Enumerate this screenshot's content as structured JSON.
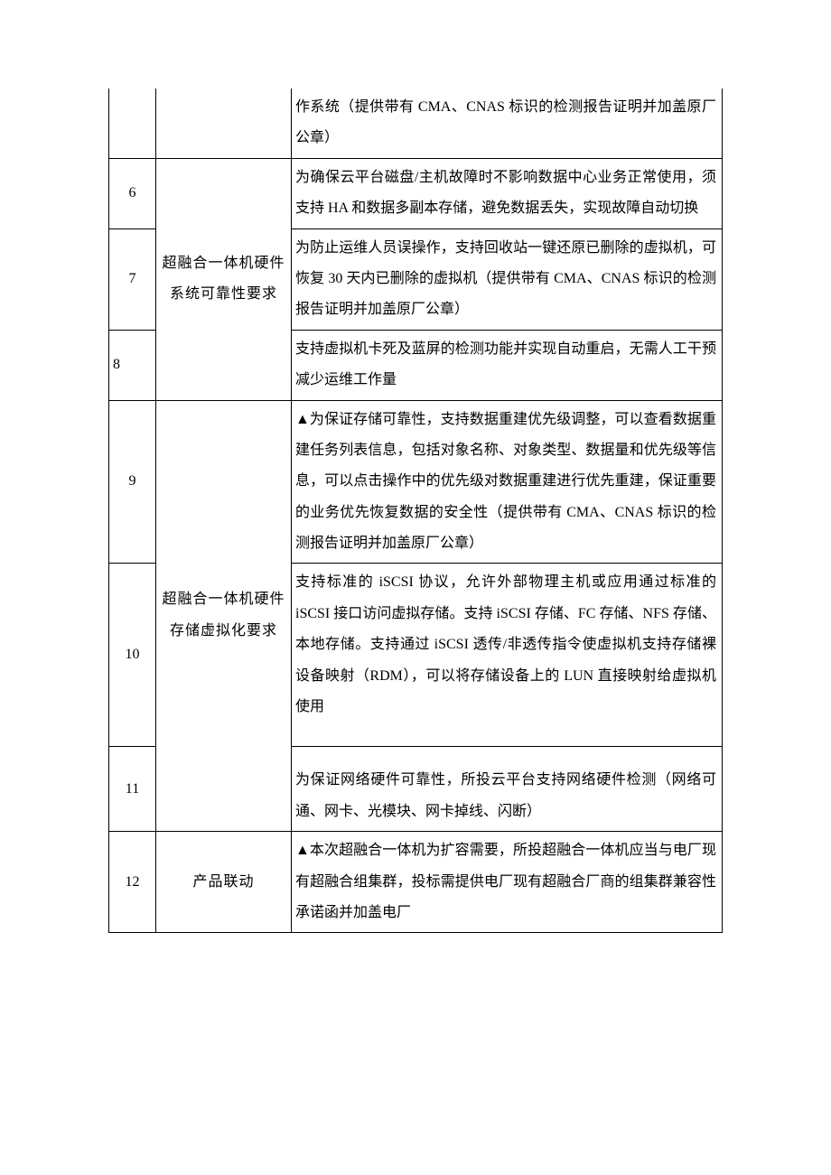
{
  "table": {
    "rows": [
      {
        "num": "",
        "cat": "",
        "desc": "作系统（提供带有 CMA、CNAS 标识的检测报告证明并加盖原厂公章）"
      },
      {
        "num": "6",
        "desc": "为确保云平台磁盘/主机故障时不影响数据中心业务正常使用，须支持 HA 和数据多副本存储，避免数据丢失，实现故障自动切换"
      },
      {
        "num": "7",
        "cat": "超融合一体机硬件系统可靠性要求",
        "desc": "为防止运维人员误操作，支持回收站一键还原已删除的虚拟机，可恢复 30 天内已删除的虚拟机（提供带有 CMA、CNAS 标识的检测报告证明并加盖原厂公章）"
      },
      {
        "num": "8",
        "desc": "支持虚拟机卡死及蓝屏的检测功能并实现自动重启，无需人工干预减少运维工作量"
      },
      {
        "num": "9",
        "desc": "▲为保证存储可靠性，支持数据重建优先级调整，可以查看数据重建任务列表信息，包括对象名称、对象类型、数据量和优先级等信息，可以点击操作中的优先级对数据重建进行优先重建，保证重要的业务优先恢复数据的安全性（提供带有 CMA、CNAS 标识的检测报告证明并加盖原厂公章）"
      },
      {
        "num": "10",
        "cat": "超融合一体机硬件存储虚拟化要求",
        "desc": "支持标准的 iSCSI 协议，允许外部物理主机或应用通过标准的 iSCSI 接口访问虚拟存储。支持 iSCSI 存储、FC 存储、NFS 存储、本地存储。支持通过 iSCSI 透传/非透传指令使虚拟机支持存储裸设备映射（RDM），可以将存储设备上的 LUN 直接映射给虚拟机使用"
      },
      {
        "num": "11",
        "desc": "为保证网络硬件可靠性，所投云平台支持网络硬件检测（网络可通、网卡、光模块、网卡掉线、闪断）"
      },
      {
        "num": "12",
        "cat": "产品联动",
        "desc": "▲本次超融合一体机为扩容需要，所投超融合一体机应当与电厂现有超融合组集群，投标需提供电厂现有超融合厂商的组集群兼容性承诺函并加盖电厂"
      }
    ]
  }
}
